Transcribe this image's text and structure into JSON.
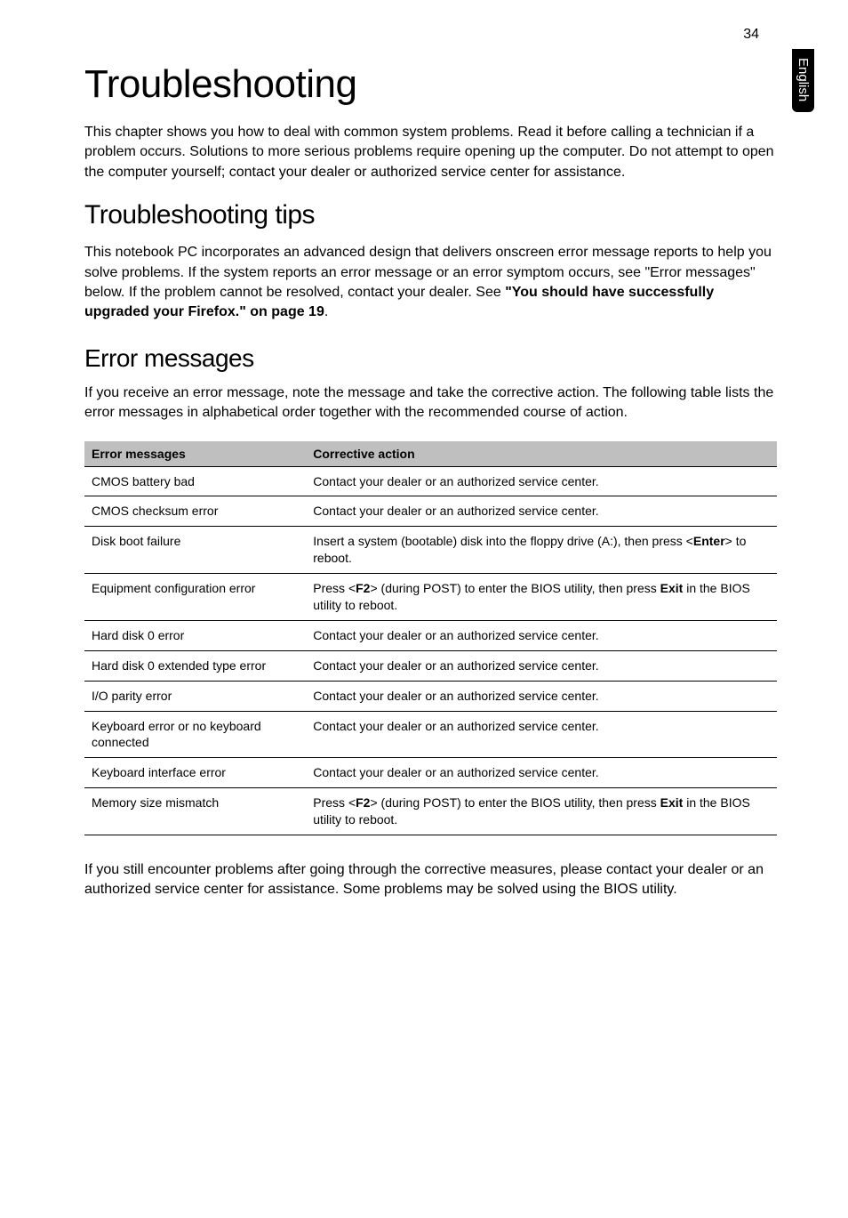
{
  "page_number": "34",
  "side_tab": "English",
  "title": "Troubleshooting",
  "intro": "This chapter shows you how to deal with common system problems. Read it before calling a technician if a problem occurs. Solutions to more serious problems require opening up the computer. Do not attempt to open the computer yourself; contact your dealer or authorized service center for assistance.",
  "tips_heading": "Troubleshooting tips",
  "tips_body_pre": "This notebook PC incorporates an advanced design that delivers onscreen error message reports to help you solve problems. If the system reports an error message or an error symptom occurs, see \"Error messages\" below. If the problem cannot be resolved, contact your dealer. See ",
  "tips_body_bold": "\"You should have successfully upgraded your Firefox.\" on page 19",
  "tips_body_post": ".",
  "error_heading": "Error messages",
  "error_body": "If you receive an error message, note the message and take the corrective action. The following table lists the error messages in alphabetical order together with the recommended course of action.",
  "table": {
    "header_error": "Error messages",
    "header_action": "Corrective action",
    "rows": [
      {
        "msg": "CMOS battery bad",
        "act_pre": "Contact your dealer or an authorized service center.",
        "bold1": "",
        "mid": "",
        "bold2": "",
        "post": ""
      },
      {
        "msg": "CMOS checksum error",
        "act_pre": "Contact your dealer or an authorized service center.",
        "bold1": "",
        "mid": "",
        "bold2": "",
        "post": ""
      },
      {
        "msg": "Disk boot failure",
        "act_pre": "Insert a system (bootable) disk into the floppy drive (A:), then press <",
        "bold1": "Enter",
        "mid": "> to reboot.",
        "bold2": "",
        "post": ""
      },
      {
        "msg": "Equipment configuration error",
        "act_pre": "Press <",
        "bold1": "F2",
        "mid": "> (during POST) to enter the BIOS utility, then press ",
        "bold2": "Exit",
        "post": " in the BIOS utility to reboot."
      },
      {
        "msg": "Hard disk 0 error",
        "act_pre": "Contact your dealer or an authorized service center.",
        "bold1": "",
        "mid": "",
        "bold2": "",
        "post": ""
      },
      {
        "msg": "Hard disk 0 extended type error",
        "act_pre": "Contact your dealer or an authorized service center.",
        "bold1": "",
        "mid": "",
        "bold2": "",
        "post": ""
      },
      {
        "msg": "I/O parity error",
        "act_pre": "Contact your dealer or an authorized service center.",
        "bold1": "",
        "mid": "",
        "bold2": "",
        "post": ""
      },
      {
        "msg": "Keyboard error or no keyboard connected",
        "act_pre": "Contact your dealer or an authorized service center.",
        "bold1": "",
        "mid": "",
        "bold2": "",
        "post": ""
      },
      {
        "msg": "Keyboard interface error",
        "act_pre": "Contact your dealer or an authorized service center.",
        "bold1": "",
        "mid": "",
        "bold2": "",
        "post": ""
      },
      {
        "msg": "Memory size mismatch",
        "act_pre": "Press <",
        "bold1": "F2",
        "mid": "> (during POST) to enter the BIOS utility, then press ",
        "bold2": "Exit",
        "post": " in the BIOS utility to reboot."
      }
    ]
  },
  "footer": "If you still encounter problems after going through the corrective measures, please contact your dealer or an authorized service center for assistance. Some problems may be solved using the BIOS utility."
}
